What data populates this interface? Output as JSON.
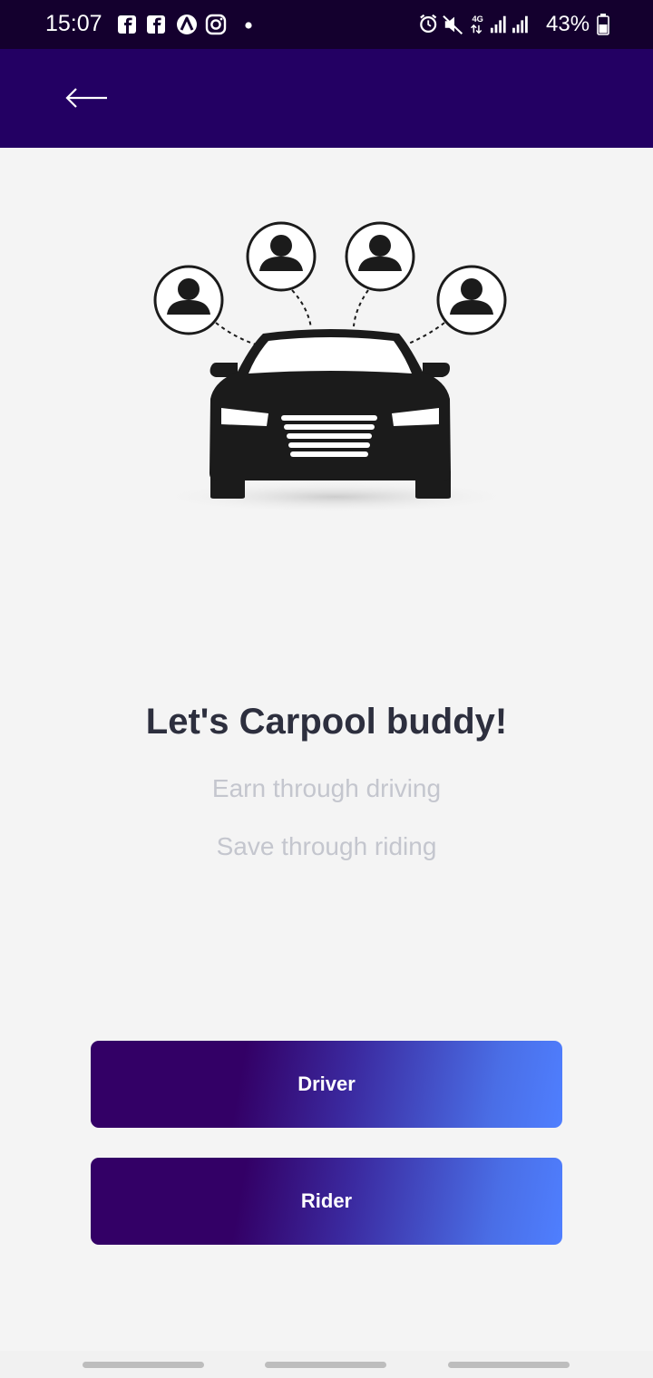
{
  "status_bar": {
    "time": "15:07",
    "battery_text": "43%",
    "left_icons": [
      "facebook-icon",
      "facebook-icon",
      "arc-app-icon",
      "instagram-icon",
      "dot-icon"
    ],
    "right_icons": [
      "alarm-icon",
      "mute-icon",
      "data-4g-icon",
      "signal-icon",
      "signal-icon",
      "battery-icon"
    ]
  },
  "app_bar": {
    "back_icon": "arrow-left-icon",
    "color": "#230063"
  },
  "hero": {
    "illustration": "car-with-passengers-icon",
    "headline": "Let's Carpool buddy!",
    "subline_1": "Earn through driving",
    "subline_2": "Save through riding"
  },
  "actions": {
    "driver_label": "Driver",
    "rider_label": "Rider",
    "gradient_start": "#330066",
    "gradient_end": "#4f7fff"
  },
  "nav_bar": {
    "pills": [
      "recents-pill",
      "home-pill",
      "back-pill"
    ]
  }
}
